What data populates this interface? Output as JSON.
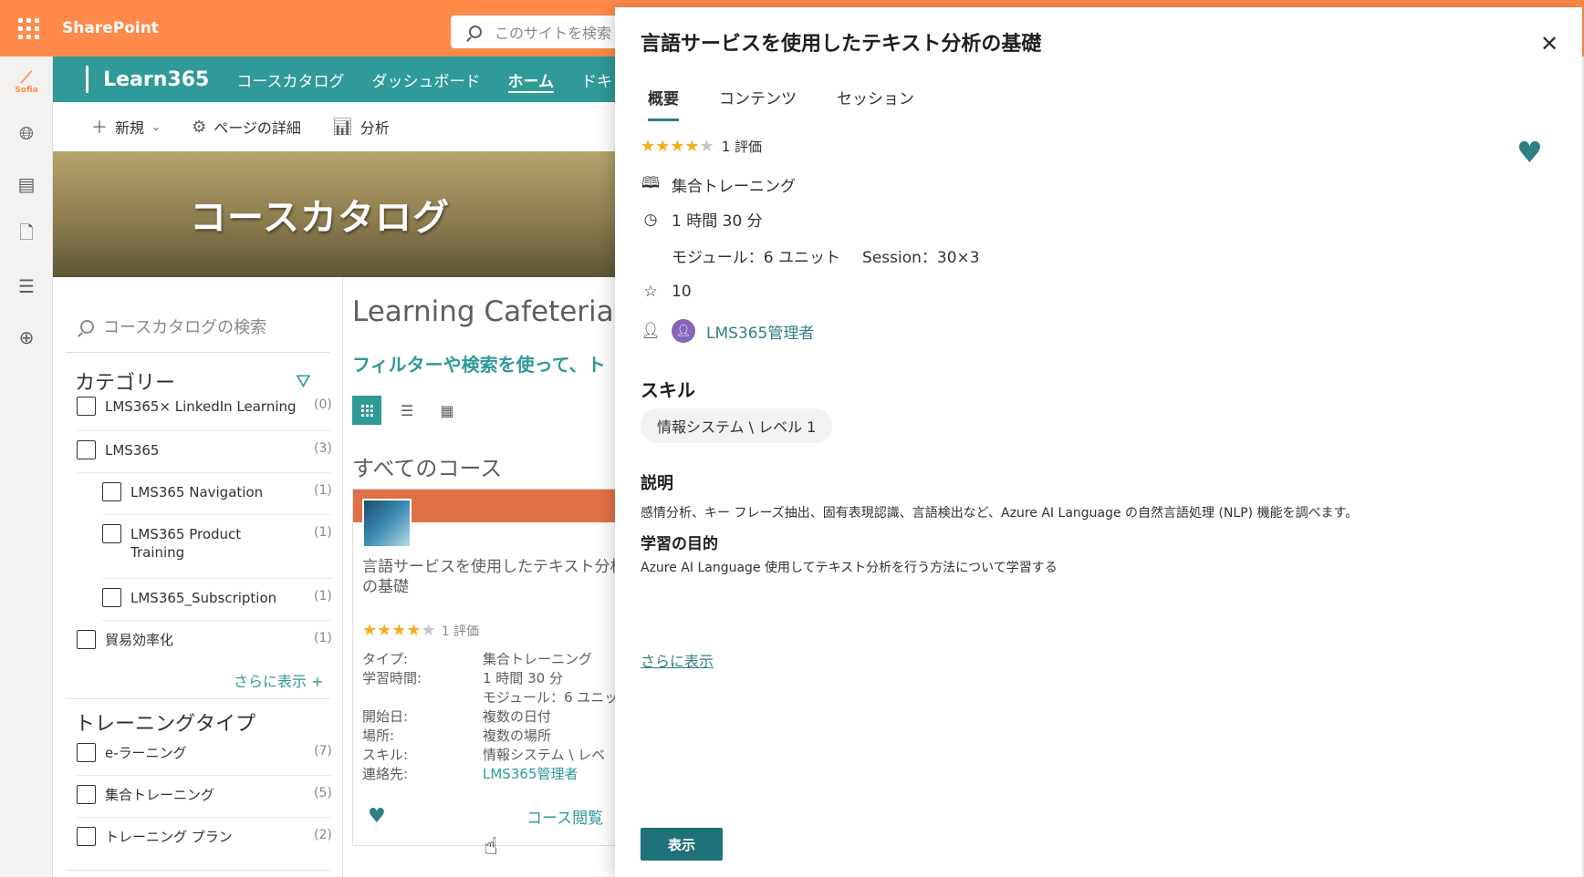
{
  "suitebar": {
    "app_name": "SharePoint",
    "search_placeholder": "このサイトを検索"
  },
  "appbar": {
    "logo_text": "Sofia",
    "items": [
      "globe-icon",
      "news-icon",
      "document-icon",
      "list-icon",
      "add-icon"
    ]
  },
  "site": {
    "name": "Learn365",
    "nav": [
      "コースカタログ",
      "ダッシュボード",
      "ホーム",
      "ドキュ"
    ],
    "active_nav": "ホーム"
  },
  "commandbar": {
    "new_label": "新規",
    "page_details_label": "ページの詳細",
    "analytics_label": "分析"
  },
  "hero": {
    "title": "コースカタログ"
  },
  "filters": {
    "search_placeholder": "コースカタログの検索",
    "category_title": "カテゴリー",
    "categories": [
      {
        "label": "LMS365× LinkedIn Learning",
        "count": "(0)"
      },
      {
        "label": "LMS365",
        "count": "(3)"
      },
      {
        "label": "LMS365 Navigation",
        "count": "(1)"
      },
      {
        "label": "LMS365 Product Training",
        "count": "(1)"
      },
      {
        "label": "LMS365_Subscription",
        "count": "(1)"
      },
      {
        "label": "貿易効率化",
        "count": "(1)"
      }
    ],
    "show_more": "さらに表示 +",
    "training_type_title": "トレーニングタイプ",
    "training_types": [
      {
        "label": "e-ラーニング",
        "count": "(7)"
      },
      {
        "label": "集合トレーニング",
        "count": "(5)"
      },
      {
        "label": "トレーニング プラン",
        "count": "(2)"
      }
    ]
  },
  "content": {
    "title": "Learning Cafeteria",
    "subtitle": "フィルターや検索を使って、ト",
    "all_courses": "すべてのコース",
    "card": {
      "title": "言語サービスを使用したテキスト分析の基礎",
      "rating_text": "1 評価",
      "rating": 4,
      "meta": [
        {
          "k": "タイプ:",
          "v": "集合トレーニング"
        },
        {
          "k": "学習時間:",
          "v": "1 時間 30 分"
        },
        {
          "k": "",
          "v": "モジュール：6 ユニッ"
        },
        {
          "k": "開始日:",
          "v": "複数の日付"
        },
        {
          "k": "場所:",
          "v": "複数の場所"
        },
        {
          "k": "スキル:",
          "v": "情報システム \\ レベ"
        },
        {
          "k": "連絡先:",
          "v": "LMS365管理者"
        }
      ],
      "view_label": "コース閲覧"
    }
  },
  "panel": {
    "title": "言語サービスを使用したテキスト分析の基礎",
    "tabs": [
      "概要",
      "コンテンツ",
      "セッション"
    ],
    "active_tab": "概要",
    "rating": 4,
    "rating_text": "1 評価",
    "type": "集合トレーニング",
    "duration": "1 時間 30 分",
    "modules": "モジュール：6 ユニット",
    "session": "Session：30×3",
    "points": "10",
    "contact": "LMS365管理者",
    "skill_heading": "スキル",
    "skill": "情報システム \\ レベル 1",
    "desc_heading": "説明",
    "desc": "感情分析、キー フレーズ抽出、固有表現認識、言語検出など、Azure AI Language の自然言語処理 (NLP) 機能を調べます。",
    "goal_heading": "学習の目的",
    "goal": "Azure AI Language 使用してテキスト分析を行う方法について学習する",
    "show_more": "さらに表示",
    "primary_button": "表示"
  },
  "colors": {
    "suitebar": "#fe8a49",
    "siteheader": "#2f9a97",
    "accent": "#2f7f83",
    "star": "#f2b01e"
  }
}
